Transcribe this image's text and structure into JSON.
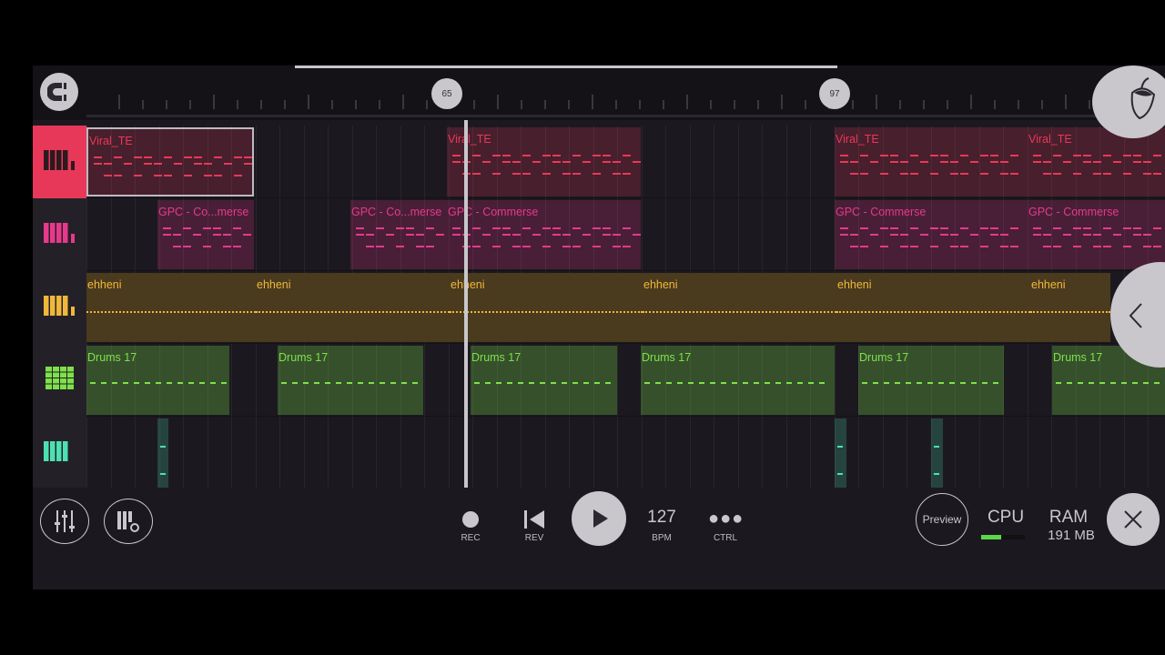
{
  "ruler": {
    "markers": [
      "65",
      "97"
    ]
  },
  "tracks": [
    {
      "name": "piano-red",
      "color": "#e8385a",
      "clips": [
        "Viral_TE",
        "Viral_TE",
        "Viral_TE",
        "Viral_TE"
      ]
    },
    {
      "name": "piano-pink",
      "color": "#e8388c",
      "clips": [
        "GPC - Co...merse",
        "GPC - Co...merse",
        "GPC - Commerse",
        "GPC - Commerse",
        "GPC - Commerse"
      ]
    },
    {
      "name": "piano-yellow",
      "color": "#f0b83a",
      "clips": [
        "ehheni",
        "ehheni",
        "ehheni",
        "ehheni",
        "ehheni",
        "ehheni"
      ]
    },
    {
      "name": "drums-green",
      "color": "#7ee04a",
      "clips": [
        "Drums 17",
        "Drums 17",
        "Drums 17",
        "Drums 17",
        "Drums 17",
        "Drums 17"
      ]
    },
    {
      "name": "piano-teal",
      "color": "#4de0b0",
      "clips": [
        "",
        "",
        ""
      ]
    }
  ],
  "transport": {
    "rec_label": "REC",
    "rev_label": "REV",
    "bpm_value": "127",
    "bpm_label": "BPM",
    "ctrl_label": "CTRL",
    "preview_label": "Preview",
    "cpu_label": "CPU",
    "cpu_level": 0.45,
    "ram_label": "RAM",
    "ram_value": "191 MB"
  }
}
